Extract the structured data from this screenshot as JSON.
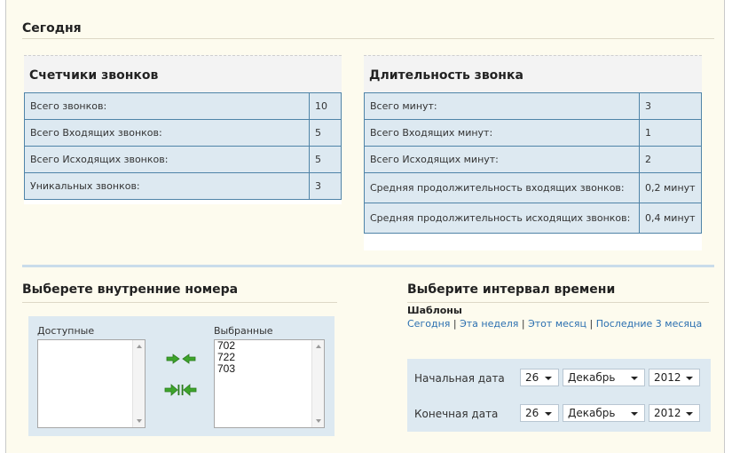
{
  "today": {
    "title": "Сегодня",
    "counters": {
      "title": "Счетчики звонков",
      "rows": [
        {
          "label": "Всего звонков:",
          "value": "10"
        },
        {
          "label": "Всего Входящих звонков:",
          "value": "5"
        },
        {
          "label": "Всего Исходящих звонков:",
          "value": "5"
        },
        {
          "label": "Уникальных звонков:",
          "value": "3"
        }
      ]
    },
    "duration": {
      "title": "Длительность звонка",
      "rows": [
        {
          "label": "Всего минут:",
          "value": "3"
        },
        {
          "label": "Всего Входящих минут:",
          "value": "1"
        },
        {
          "label": "Всего Исходящих минут:",
          "value": "2"
        },
        {
          "label": "Средняя продолжительность входящих звонков:",
          "value": "0,2 минут"
        },
        {
          "label": "Средняя продолжительность исходящих звонков:",
          "value": "0,4 минут"
        }
      ]
    }
  },
  "extensions": {
    "title": "Выберете внутренние номера",
    "available_label": "Доступные",
    "available": [],
    "selected_label": "Выбранные",
    "selected": [
      "702",
      "722",
      "703"
    ]
  },
  "interval": {
    "title": "Выберите интервал времени",
    "templates_label": "Шаблоны",
    "links": [
      "Сегодня",
      "Эта неделя",
      "Этот месяц",
      "Последние 3 месяца"
    ],
    "separator": " | ",
    "start": {
      "label": "Начальная дата",
      "day": "26",
      "month": "Декабрь",
      "year": "2012"
    },
    "end": {
      "label": "Конечная дата",
      "day": "26",
      "month": "Декабрь",
      "year": "2012"
    }
  },
  "colors": {
    "background": "#fdfbee",
    "cell": "#dde9f1",
    "cell_border": "#4f84a8",
    "link": "#2a6fb0",
    "arrow_green": "#3da52c"
  },
  "icons": {
    "move_buttons": [
      "move-right-icon",
      "move-left-icon",
      "move-all-right-icon",
      "move-all-left-icon"
    ]
  }
}
